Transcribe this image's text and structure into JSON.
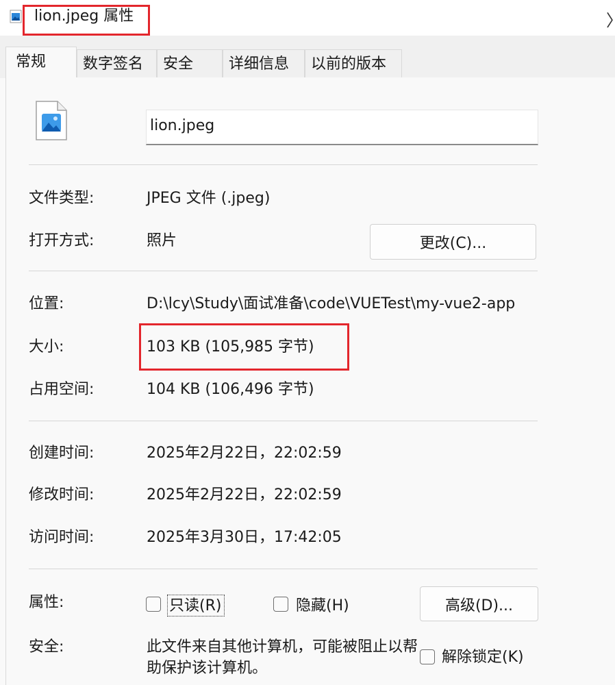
{
  "window": {
    "title": "lion.jpeg 属性",
    "close_glyph": "〉",
    "title_icon": "image-file-icon"
  },
  "tabs": [
    {
      "label": "常规",
      "active": true
    },
    {
      "label": "数字签名",
      "active": false
    },
    {
      "label": "安全",
      "active": false
    },
    {
      "label": "详细信息",
      "active": false
    },
    {
      "label": "以前的版本",
      "active": false
    }
  ],
  "general": {
    "file_icon": "photo-file-icon",
    "file_name": "lion.jpeg",
    "type_label": "文件类型:",
    "type_value": "JPEG 文件 (.jpeg)",
    "opens_with_label": "打开方式:",
    "opens_with_value": "照片",
    "change_button": "更改(C)...",
    "location_label": "位置:",
    "location_value": "D:\\lcy\\Study\\面试准备\\code\\VUETest\\my-vue2-app",
    "size_label": "大小:",
    "size_value": "103 KB (105,985 字节)",
    "size_on_disk_label": "占用空间:",
    "size_on_disk_value": "104 KB (106,496 字节)",
    "created_label": "创建时间:",
    "created_value": "2025年2月22日，22:02:59",
    "modified_label": "修改时间:",
    "modified_value": "2025年2月22日，22:02:59",
    "accessed_label": "访问时间:",
    "accessed_value": "2025年3月30日，17:42:05",
    "attributes_label": "属性:",
    "readonly_label": "只读(R)",
    "readonly_checked": false,
    "hidden_label": "隐藏(H)",
    "hidden_checked": false,
    "advanced_button": "高级(D)...",
    "security_label": "安全:",
    "security_text": "此文件来自其他计算机，可能被阻止以帮助保护该计算机。",
    "unblock_label": "解除锁定(K)",
    "unblock_checked": false
  },
  "colors": {
    "highlight": "#e3262c",
    "tab_bg": "#f0f0f0",
    "panel_bg": "#f9f9f9"
  }
}
